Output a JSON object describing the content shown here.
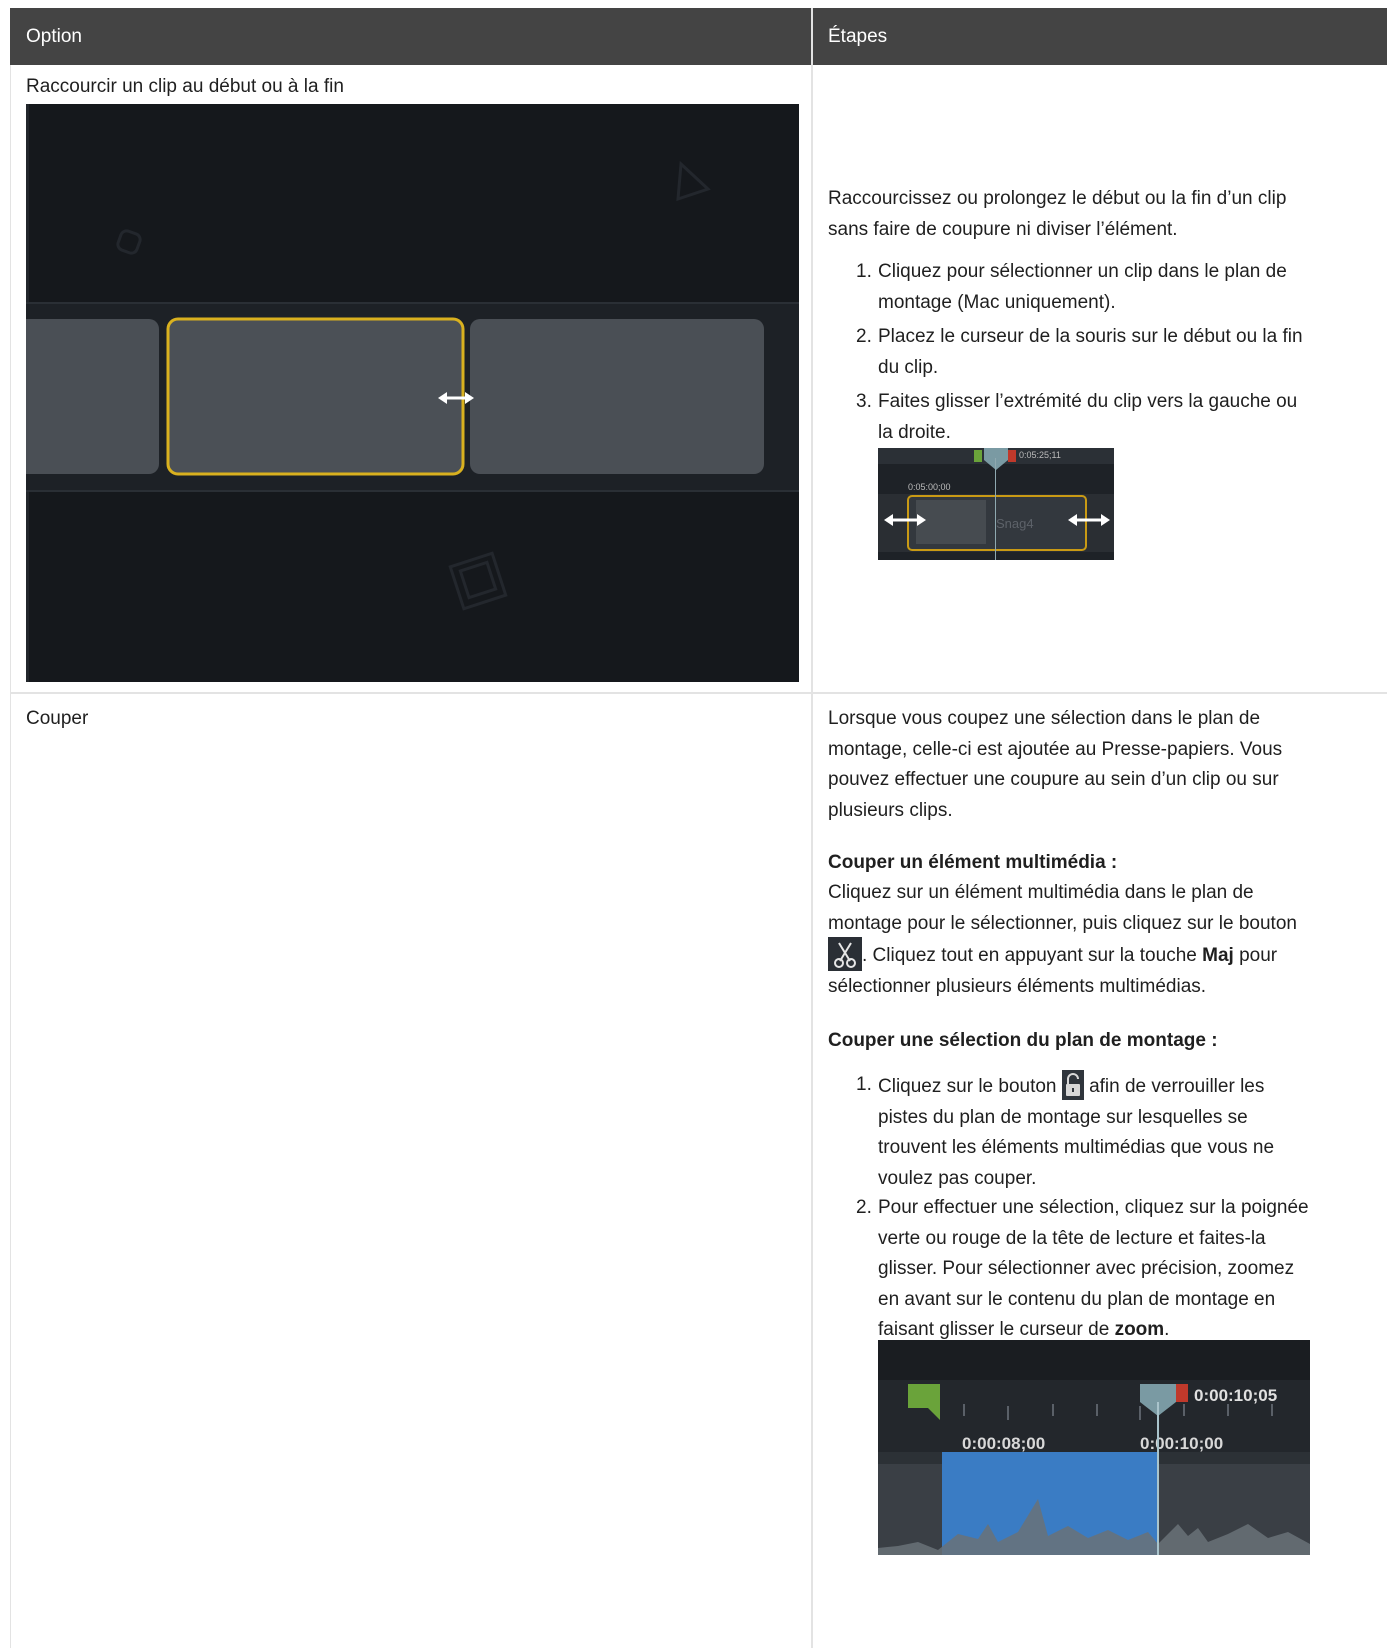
{
  "table": {
    "headers": [
      "Option",
      "Étapes"
    ],
    "rows": [
      {
        "option": "Raccourcir un clip au début ou à la fin",
        "intro": "Raccourcissez ou prolongez le début ou la fin d’un clip sans faire de coupure ni diviser l’élément.",
        "steps": [
          "Cliquez pour sélectionner un clip dans le plan de montage (Mac uniquement).",
          "Placez le curseur de la souris sur le début ou la fin du clip.",
          "Faites glisser l’extrémité du clip vers la gauche ou la droite."
        ],
        "screenshot": {
          "time_top": "0:05:25;11",
          "time_left": "0:05:00;00",
          "clip_label": "Snag4"
        }
      },
      {
        "option": "Couper",
        "intro": "Lorsque vous coupez une sélection dans le plan de montage, celle-ci est ajoutée au Presse-papiers. Vous pouvez effectuer une coupure au sein d’un clip ou sur plusieurs clips.",
        "section1_title": "Couper un élément multimédia :",
        "section1_a": "Cliquez sur un élément multimédia dans le plan de montage pour le sélectionner, puis cliquez sur le bouton",
        "section1_b": ". Cliquez tout en appuyant sur la touche",
        "section1_key": "Maj",
        "section1_c": "pour sélectionner plusieurs éléments multimédias.",
        "section2_title": "Couper une sélection du plan de montage :",
        "step1_a": "Cliquez sur le bouton",
        "step1_b": "afin de verrouiller les pistes du plan de montage sur lesquelles se trouvent les éléments multimédias que vous ne voulez pas couper.",
        "step2_a": "Pour effectuer une sélection, cliquez sur la poignée verte ou rouge de la tête de lecture et faites-la glisser. Pour sélectionner avec précision, zoomez en avant sur le contenu du plan de montage en faisant glisser le curseur de",
        "step2_bold": "zoom",
        "step2_end": ".",
        "screenshot": {
          "time_top": "0:00:10;05",
          "tick_left": "0:00:08;00",
          "tick_right": "0:00:10;00"
        }
      }
    ]
  },
  "icons": [
    "scissors-icon",
    "unlock-icon",
    "resize-arrow-icon"
  ],
  "colors": {
    "header_bg": "#444444",
    "clip_highlight": "#d9b11f",
    "selection_blue": "#3a7cc4",
    "handle_green": "#6aa33a",
    "handle_red": "#c0392b"
  }
}
